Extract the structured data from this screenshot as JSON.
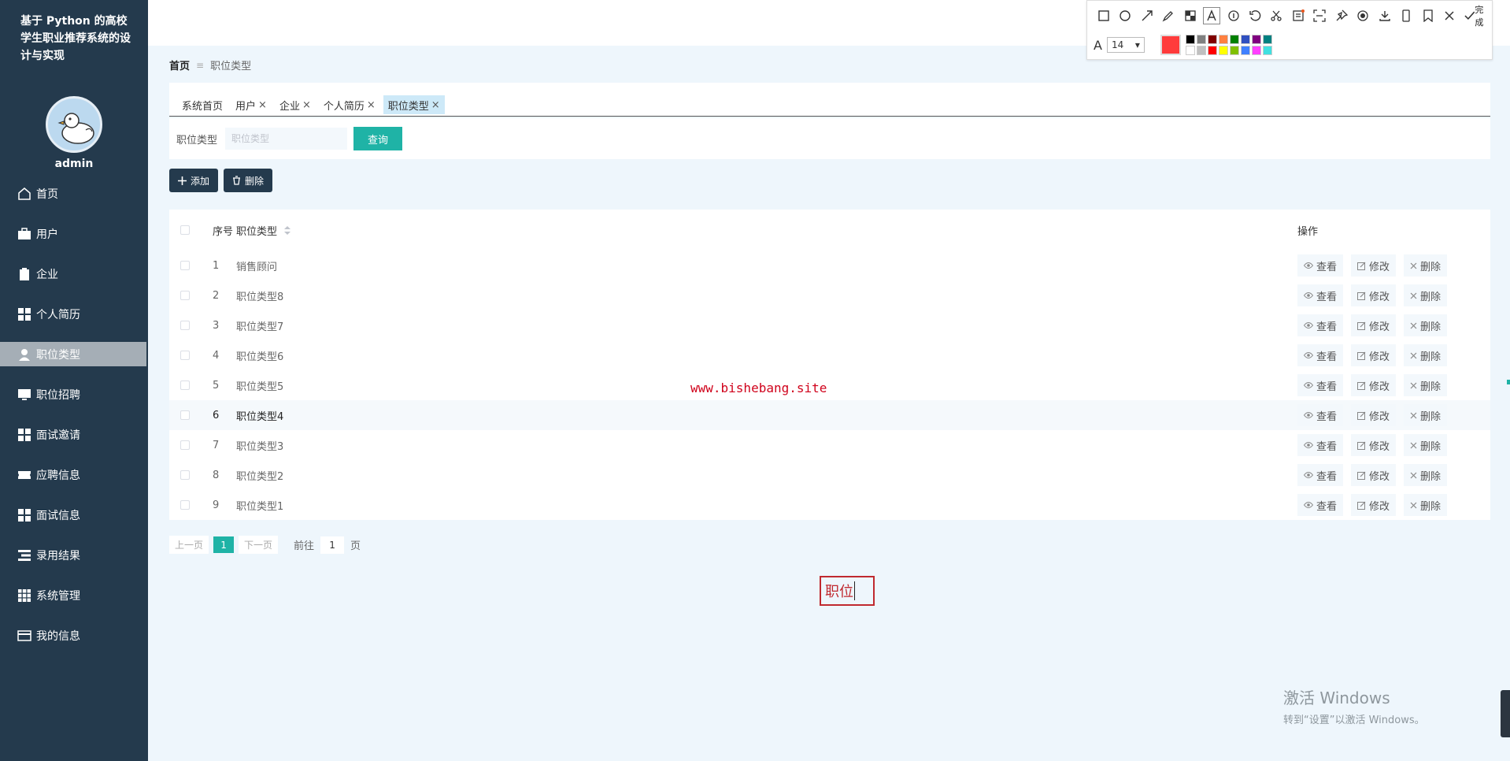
{
  "app": {
    "title": "基于 Python 的高校学生职业推荐系统的设计与实现",
    "username": "admin"
  },
  "sidebar": {
    "items": [
      {
        "label": "首页",
        "icon": "home-icon",
        "active": false
      },
      {
        "label": "用户",
        "icon": "briefcase-icon",
        "active": false
      },
      {
        "label": "企业",
        "icon": "clipboard-icon",
        "active": false
      },
      {
        "label": "个人简历",
        "icon": "grid-icon",
        "active": false
      },
      {
        "label": "职位类型",
        "icon": "user-icon",
        "active": true
      },
      {
        "label": "职位招聘",
        "icon": "monitor-icon",
        "active": false
      },
      {
        "label": "面试邀请",
        "icon": "grid-icon",
        "active": false
      },
      {
        "label": "应聘信息",
        "icon": "ticket-icon",
        "active": false
      },
      {
        "label": "面试信息",
        "icon": "grid-icon",
        "active": false
      },
      {
        "label": "录用结果",
        "icon": "list-icon",
        "active": false
      },
      {
        "label": "系统管理",
        "icon": "apps-icon",
        "active": false
      },
      {
        "label": "我的信息",
        "icon": "card-icon",
        "active": false
      }
    ]
  },
  "breadcrumb": {
    "home": "首页",
    "separator": "≡",
    "current": "职位类型"
  },
  "tabs": [
    {
      "label": "系统首页",
      "closable": false,
      "active": false
    },
    {
      "label": "用户",
      "closable": true,
      "active": false
    },
    {
      "label": "企业",
      "closable": true,
      "active": false
    },
    {
      "label": "个人简历",
      "closable": true,
      "active": false
    },
    {
      "label": "职位类型",
      "closable": true,
      "active": true
    }
  ],
  "search": {
    "label": "职位类型",
    "placeholder": "职位类型",
    "value": "",
    "button": "查询"
  },
  "toolbar": {
    "add_label": "添加",
    "delete_label": "删除"
  },
  "table": {
    "headers": {
      "index": "序号",
      "name": "职位类型",
      "ops": "操作"
    },
    "op_labels": {
      "view": "查看",
      "edit": "修改",
      "delete": "删除"
    },
    "rows": [
      {
        "index": "1",
        "name": "销售顾问"
      },
      {
        "index": "2",
        "name": "职位类型8"
      },
      {
        "index": "3",
        "name": "职位类型7"
      },
      {
        "index": "4",
        "name": "职位类型6"
      },
      {
        "index": "5",
        "name": "职位类型5"
      },
      {
        "index": "6",
        "name": "职位类型4"
      },
      {
        "index": "7",
        "name": "职位类型3"
      },
      {
        "index": "8",
        "name": "职位类型2"
      },
      {
        "index": "9",
        "name": "职位类型1"
      }
    ],
    "hover_row": 5
  },
  "pagination": {
    "prev": "上一页",
    "current": "1",
    "next": "下一页",
    "goto_label": "前往",
    "goto_value": "1",
    "unit": "页"
  },
  "overlays": {
    "watermark": "www.bishebang.site",
    "annotation_text": "职位",
    "windows_title": "激活 Windows",
    "windows_sub": "转到“设置”以激活 Windows。"
  },
  "snip_toolbar": {
    "done_label": "完成",
    "font_size": "14",
    "current_color": "#ff3b3b",
    "palette": [
      "#000000",
      "#808080",
      "#800000",
      "#ff8040",
      "#008000",
      "#3050c0",
      "#800080",
      "#008080",
      "#ffffff",
      "#c0c0c0",
      "#ff0000",
      "#ffff00",
      "#80c000",
      "#4080ff",
      "#ff40ff",
      "#40e0e0"
    ]
  },
  "colors": {
    "sidebar_bg": "#243a4d",
    "accent": "#1fb3a6",
    "page_bg": "#eef6fc",
    "dark_button": "#243a4d"
  }
}
